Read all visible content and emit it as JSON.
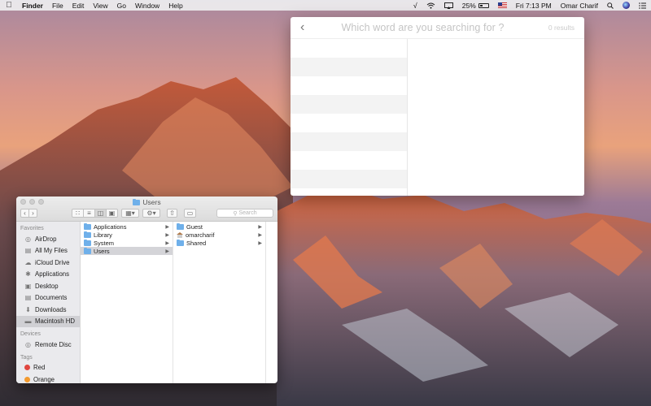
{
  "menubar": {
    "app_name": "Finder",
    "menus": [
      "File",
      "Edit",
      "View",
      "Go",
      "Window",
      "Help"
    ],
    "battery_percent": "25%",
    "clock": "Fri 7:13 PM",
    "user_name": "Omar Charif"
  },
  "popup": {
    "search_placeholder": "Which word are you searching for ?",
    "results_count": "0 results"
  },
  "finder": {
    "window_title": "Users",
    "search_placeholder": "Search",
    "sidebar": {
      "favorites_title": "Favorites",
      "favorites": [
        {
          "label": "AirDrop",
          "icon": "airdrop-icon"
        },
        {
          "label": "All My Files",
          "icon": "all-files-icon"
        },
        {
          "label": "iCloud Drive",
          "icon": "cloud-icon"
        },
        {
          "label": "Applications",
          "icon": "applications-icon"
        },
        {
          "label": "Desktop",
          "icon": "desktop-icon"
        },
        {
          "label": "Documents",
          "icon": "document-icon"
        },
        {
          "label": "Downloads",
          "icon": "download-icon"
        },
        {
          "label": "Macintosh HD",
          "icon": "hard-drive-icon"
        }
      ],
      "devices_title": "Devices",
      "devices": [
        {
          "label": "Remote Disc",
          "icon": "disc-icon"
        }
      ],
      "tags_title": "Tags",
      "tags": [
        {
          "label": "Red",
          "color": "#e0463f"
        },
        {
          "label": "Orange",
          "color": "#f39a2e"
        }
      ]
    },
    "column1": [
      "Applications",
      "Library",
      "System",
      "Users"
    ],
    "column2": [
      "Guest",
      "omarcharif",
      "Shared"
    ]
  },
  "colors": {
    "folder_blue": "#6fb0ea",
    "selection_gray": "#d4d4d8"
  }
}
